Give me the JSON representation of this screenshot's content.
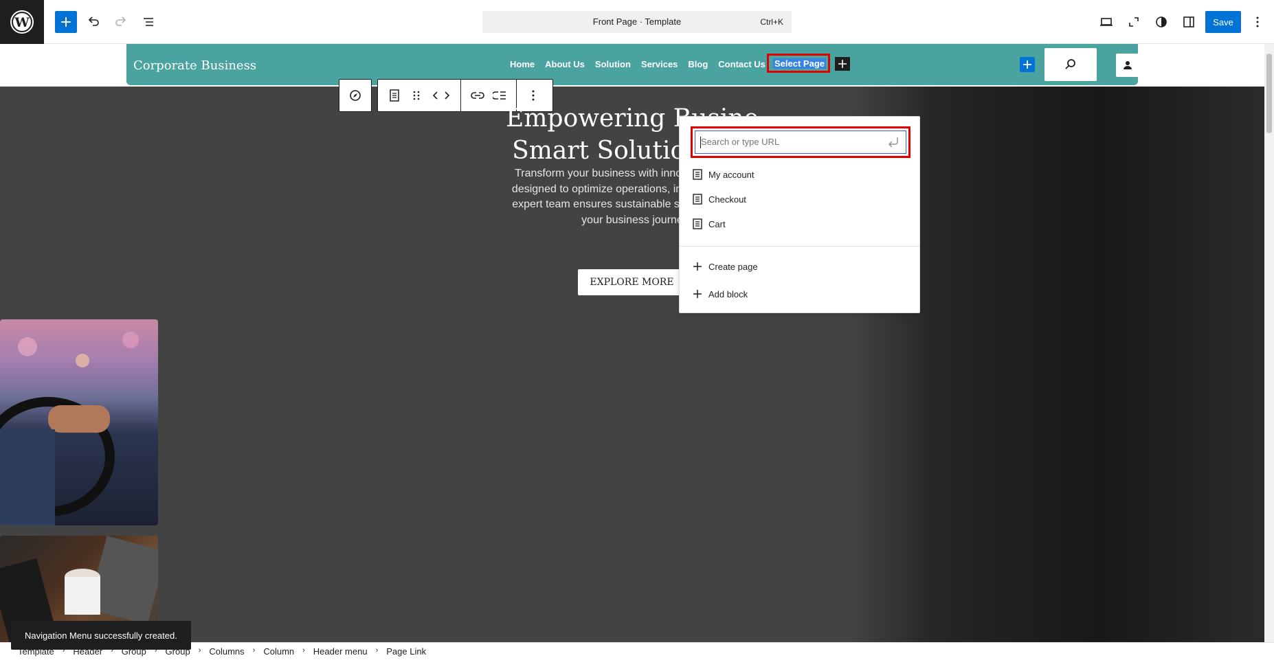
{
  "topbar": {
    "command_title": "Front Page · Template",
    "command_shortcut": "Ctrl+K",
    "save_label": "Save"
  },
  "header": {
    "site_title": "Corporate Business",
    "nav": [
      "Home",
      "About Us",
      "Solution",
      "Services",
      "Blog",
      "Contact Us"
    ],
    "nav_selected": "Select Page"
  },
  "hero": {
    "title_line1": "Empowering Busine",
    "title_line2": "Smart Solutions Fo",
    "text_lines": [
      "Transform your business with innovative strategi",
      "designed to optimize operations, increase efficien",
      "expert team ensures sustainable success by guid",
      "your business journe"
    ],
    "button_label": "EXPLORE MORE"
  },
  "link_popover": {
    "placeholder": "Search or type URL",
    "suggestions": [
      "My account",
      "Checkout",
      "Cart"
    ],
    "actions": [
      "Create page",
      "Add block"
    ]
  },
  "breadcrumb": [
    "Template",
    "Header",
    "Group",
    "Group",
    "Columns",
    "Column",
    "Header menu",
    "Page Link"
  ],
  "snackbar": "Navigation Menu successfully created.",
  "colors": {
    "accent": "#0073d5",
    "header_bg": "#4ba3a0",
    "hero_bg": "#434343",
    "highlight": "#e00000"
  }
}
